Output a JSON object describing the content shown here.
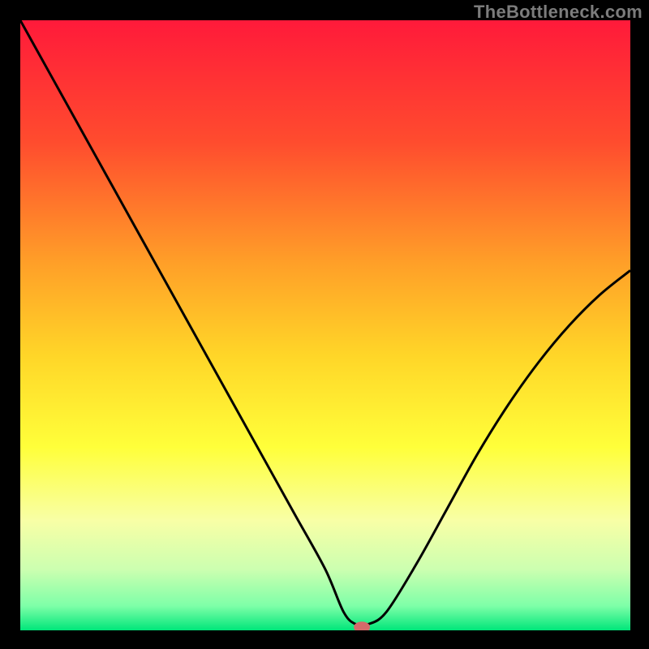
{
  "watermark": "TheBottleneck.com",
  "chart_data": {
    "type": "line",
    "title": "",
    "xlabel": "",
    "ylabel": "",
    "xlim": [
      0,
      100
    ],
    "ylim": [
      0,
      100
    ],
    "background_gradient": {
      "stops": [
        {
          "offset": 0,
          "color": "#ff1a3a"
        },
        {
          "offset": 20,
          "color": "#ff4c2e"
        },
        {
          "offset": 40,
          "color": "#ffa028"
        },
        {
          "offset": 55,
          "color": "#ffd628"
        },
        {
          "offset": 70,
          "color": "#ffff3a"
        },
        {
          "offset": 82,
          "color": "#f8ffa6"
        },
        {
          "offset": 90,
          "color": "#ccffb0"
        },
        {
          "offset": 96,
          "color": "#7effa8"
        },
        {
          "offset": 100,
          "color": "#00e67a"
        }
      ]
    },
    "series": [
      {
        "name": "bottleneck-curve",
        "color": "#000000",
        "x": [
          0,
          5,
          10,
          15,
          20,
          25,
          30,
          35,
          40,
          45,
          50,
          53,
          55,
          57,
          60,
          65,
          70,
          75,
          80,
          85,
          90,
          95,
          100
        ],
        "y": [
          100,
          91,
          82,
          73,
          64,
          55,
          46,
          37,
          28,
          19,
          10,
          3,
          1,
          1,
          3,
          11,
          20,
          29,
          37,
          44,
          50,
          55,
          59
        ]
      }
    ],
    "marker": {
      "name": "optimum-point",
      "x": 56,
      "y": 0.5,
      "rx": 10,
      "ry": 7,
      "color": "#d46a6a"
    }
  }
}
